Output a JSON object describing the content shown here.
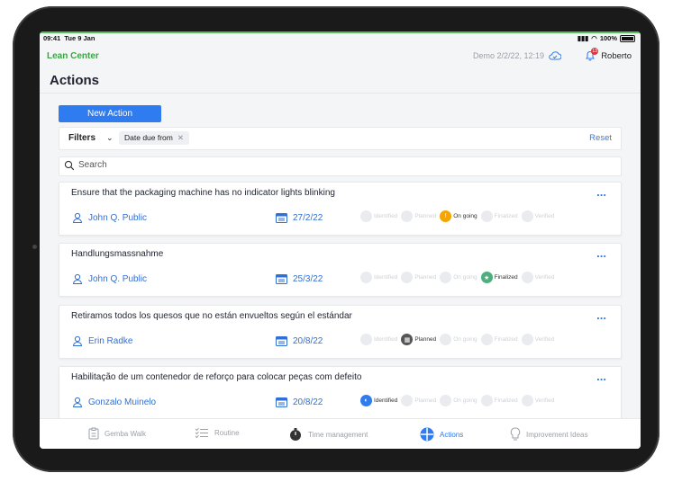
{
  "status": {
    "time": "09:41",
    "date": "Tue 9 Jan",
    "battery": "100%"
  },
  "header": {
    "brand": "Lean Center",
    "demo_info": "Demo 2/2/22, 12:19",
    "notification_count": "13",
    "user": "Roberto"
  },
  "page": {
    "title": "Actions"
  },
  "toolbar": {
    "new_action": "New Action"
  },
  "filters": {
    "label": "Filters",
    "chip": "Date due from",
    "reset": "Reset"
  },
  "search": {
    "placeholder": "Search",
    "value": ""
  },
  "step_labels": [
    "Identified",
    "Planned",
    "On going",
    "Finalized",
    "Verified"
  ],
  "cards": [
    {
      "title": "Ensure that the packaging machine has no indicator lights blinking",
      "owner": "John Q. Public",
      "date": "27/2/22",
      "active_step": "On going",
      "more": "..."
    },
    {
      "title": "Handlungsmassnahme",
      "owner": "John Q. Public",
      "date": "25/3/22",
      "active_step": "Finalized",
      "more": "..."
    },
    {
      "title": "Retiramos todos los quesos que no están envueltos según el estándar",
      "owner": "Erin Radke",
      "date": "20/8/22",
      "active_step": "Planned",
      "more": "..."
    },
    {
      "title": "Habilitação de um contenedor de reforço para colocar peças com defeito",
      "owner": "Gonzalo Muinelo",
      "date": "20/8/22",
      "active_step": "Identified",
      "more": "..."
    }
  ],
  "tabs": [
    {
      "label": "Gemba Walk",
      "icon": "clipboard-icon"
    },
    {
      "label": "Routine",
      "icon": "checklist-icon"
    },
    {
      "label": "Time management",
      "icon": "stopwatch-icon"
    },
    {
      "label": "Actions",
      "icon": "actions-icon",
      "active": true
    },
    {
      "label": "Improvement Ideas",
      "icon": "lightbulb-icon"
    }
  ],
  "colors": {
    "accent": "#2f7bf0",
    "brand": "#3aa543",
    "ongoing": "#f5a400",
    "finalized": "#4caf7d",
    "planned": "#555555",
    "identified": "#2f7bf0"
  }
}
